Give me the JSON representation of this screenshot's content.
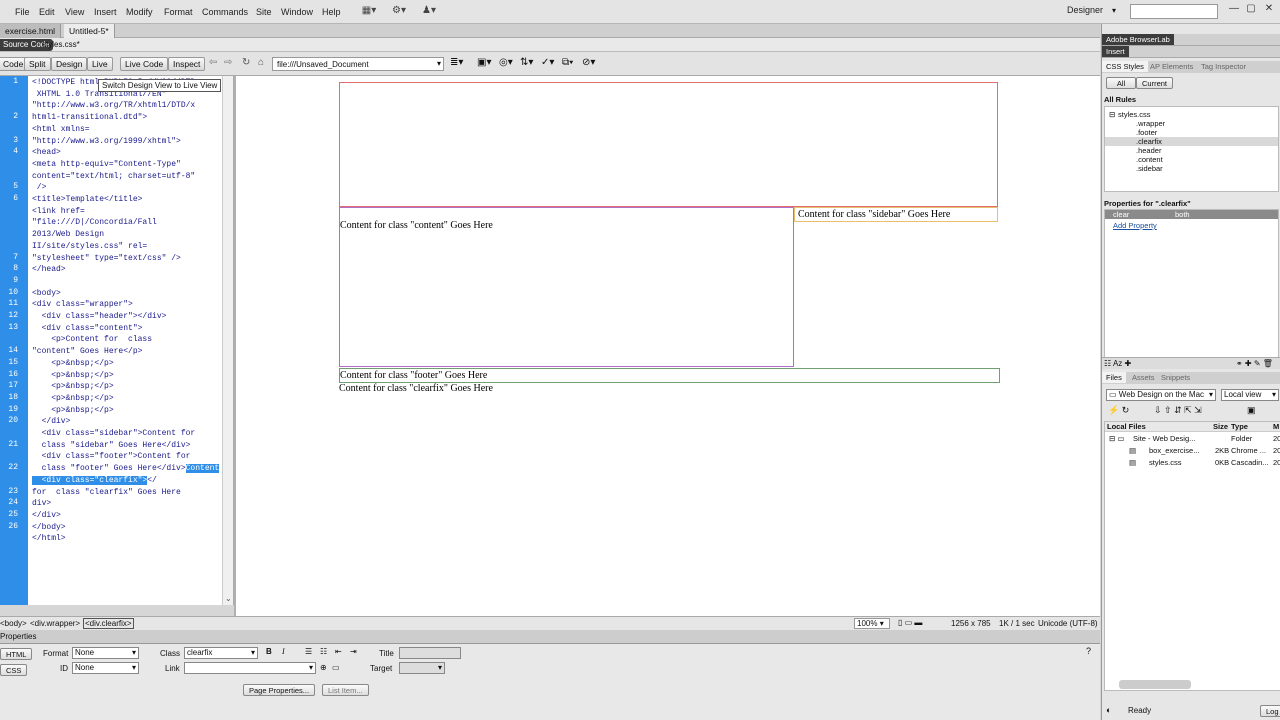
{
  "menubar": {
    "items": [
      "File",
      "Edit",
      "View",
      "Insert",
      "Modify",
      "Format",
      "Commands",
      "Site",
      "Window",
      "Help"
    ],
    "workspace": "Designer",
    "search_placeholder": ""
  },
  "doc_tabs": {
    "tabs": [
      "exercise.html",
      "Untitled-5*"
    ],
    "active": "Untitled-5*"
  },
  "related": {
    "source": "Source Code",
    "file": "styles.css*"
  },
  "toolbar": {
    "code": "Code",
    "split": "Split",
    "design": "Design",
    "live": "Live",
    "live_code": "Live Code",
    "inspect": "Inspect",
    "address": "file:///Unsaved_Document",
    "tooltip": "Switch Design View to Live View"
  },
  "code": {
    "line_numbers": [
      "1",
      "",
      "",
      "2",
      "",
      "3",
      "4",
      "",
      "",
      "5",
      "6",
      "",
      "",
      "",
      "",
      "7",
      "8",
      "9",
      "10",
      "11",
      "12",
      "13",
      "",
      "14",
      "15",
      "16",
      "17",
      "18",
      "19",
      "20",
      "",
      "21",
      "",
      "22",
      "",
      "23",
      "24",
      "25",
      "26"
    ],
    "lines": [
      "<!DOCTYPE html PUBLIC \"-//W3C//DTD",
      " XHTML 1.0 Transitional//EN\"",
      "\"http://www.w3.org/TR/xhtml1/DTD/x",
      "html1-transitional.dtd\">",
      "<html xmlns=",
      "\"http://www.w3.org/1999/xhtml\">",
      "<head>",
      "<meta http-equiv=\"Content-Type\"",
      "content=\"text/html; charset=utf-8\"",
      " />",
      "<title>Template</title>",
      "<link href=",
      "\"file:///D|/Concordia/Fall",
      "2013/Web Design",
      "II/site/styles.css\" rel=",
      "\"stylesheet\" type=\"text/css\" />",
      "</head>",
      "",
      "<body>",
      "<div class=\"wrapper\">",
      "  <div class=\"header\"></div>",
      "  <div class=\"content\">",
      "    <p>Content for  class",
      "\"content\" Goes Here</p>",
      "    <p>&nbsp;</p>",
      "    <p>&nbsp;</p>",
      "    <p>&nbsp;</p>",
      "    <p>&nbsp;</p>",
      "    <p>&nbsp;</p>",
      "  </div>",
      "  <div class=\"sidebar\">Content for",
      "  class \"sidebar\" Goes Here</div>",
      "  <div class=\"footer\">Content for",
      "  class \"footer\" Goes Here</div>",
      "  <div class=\"clearfix\">",
      "for  class \"clearfix\" Goes Here",
      "div>",
      "</div>",
      "</body>",
      "</html>"
    ],
    "selected_start": "Content",
    "closing_tail": "</"
  },
  "design": {
    "content_text": "Content for class \"content\" Goes Here",
    "sidebar_text": "Content for class \"sidebar\" Goes Here",
    "footer_text": "Content for class \"footer\" Goes Here",
    "clearfix_text": "Content for class \"clearfix\" Goes Here"
  },
  "status": {
    "tag_selector": [
      "<body>",
      "<div.wrapper>",
      "<div.clearfix>"
    ],
    "zoom": "100%",
    "dimensions": "1256 x 785",
    "download": "1K / 1 sec",
    "encoding": "Unicode (UTF-8)"
  },
  "properties": {
    "title": "Properties",
    "html": "HTML",
    "css": "CSS",
    "format_label": "Format",
    "format_value": "None",
    "id_label": "ID",
    "id_value": "None",
    "class_label": "Class",
    "class_value": "clearfix",
    "link_label": "Link",
    "title_label": "Title",
    "target_label": "Target",
    "page_props": "Page Properties...",
    "list_item": "List Item..."
  },
  "right": {
    "browserlab": "Adobe BrowserLab",
    "insert": "Insert",
    "css_tabs": [
      "CSS Styles",
      "AP Elements",
      "Tag Inspector"
    ],
    "all": "All",
    "current": "Current",
    "all_rules": "All Rules",
    "rules": [
      "styles.css",
      ".wrapper",
      ".footer",
      ".clearfix",
      ".header",
      ".content",
      ".sidebar"
    ],
    "props_for": "Properties for \".clearfix\"",
    "prop_name": "clear",
    "prop_value": "both",
    "add_property": "Add Property",
    "files_tabs": [
      "Files",
      "Assets",
      "Snippets"
    ],
    "site": "Web Design on the Mac",
    "view": "Local view",
    "cols": [
      "Local Files",
      "Size",
      "Type",
      "M"
    ],
    "files": [
      {
        "name": "Site - Web Desig...",
        "size": "",
        "type": "Folder",
        "mod": "20"
      },
      {
        "name": "box_exercise...",
        "size": "2KB",
        "type": "Chrome ...",
        "mod": "20"
      },
      {
        "name": "styles.css",
        "size": "0KB",
        "type": "Cascadin...",
        "mod": "20"
      }
    ],
    "ready": "Ready",
    "log": "Log"
  }
}
